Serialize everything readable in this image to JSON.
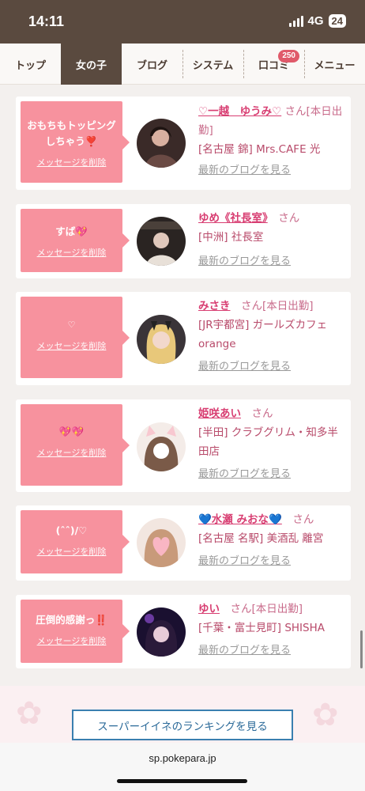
{
  "status": {
    "time": "14:11",
    "network": "4G",
    "battery": "24"
  },
  "tabs": [
    {
      "label": "トップ"
    },
    {
      "label": "女の子"
    },
    {
      "label": "ブログ"
    },
    {
      "label": "システム"
    },
    {
      "label": "口コミ",
      "badge": "250"
    },
    {
      "label": "メニュー"
    }
  ],
  "cards": [
    {
      "message": "おもちもトッピングしちゃう❣️",
      "delete_label": "メッセージを削除",
      "name": "♡一越　ゆうみ♡",
      "suffix": "さん[本日出勤]",
      "shop": "[名古屋 錦] Mrs.CAFE 光",
      "blog": "最新のブログを見る"
    },
    {
      "message": "すば💖",
      "delete_label": "メッセージを削除",
      "name": "ゆめ《社長室》",
      "suffix": "さん",
      "shop": "[中洲] 社長室",
      "blog": "最新のブログを見る"
    },
    {
      "message": "♡",
      "delete_label": "メッセージを削除",
      "name": "みさき",
      "suffix": "さん[本日出勤]",
      "shop": "[JR宇都宮] ガールズカフェ orange",
      "blog": "最新のブログを見る"
    },
    {
      "message": "💖💖",
      "delete_label": "メッセージを削除",
      "name": "姫咲あい",
      "suffix": "さん",
      "shop": "[半田] クラブグリム・知多半田店",
      "blog": "最新のブログを見る"
    },
    {
      "message": "(ˆˆ)/♡",
      "delete_label": "メッセージを削除",
      "name": "💙水瀬 みおな💙",
      "suffix": "さん",
      "shop": "[名古屋 名駅] 美酒乱 離宮",
      "blog": "最新のブログを見る"
    },
    {
      "message": "圧倒的感謝っ‼️",
      "delete_label": "メッセージを削除",
      "name": "ゆい",
      "suffix": "さん[本日出勤]",
      "shop": "[千葉・富士見町] SHISHA",
      "blog": "最新のブログを見る"
    }
  ],
  "ranking_button": "スーパーイイネのランキングを見る",
  "url": "sp.pokepara.jp",
  "colors": {
    "brown": "#5a4a3f",
    "pink": "#f7929e",
    "name_pink": "#d83e72",
    "link_blue": "#2b6a99"
  }
}
